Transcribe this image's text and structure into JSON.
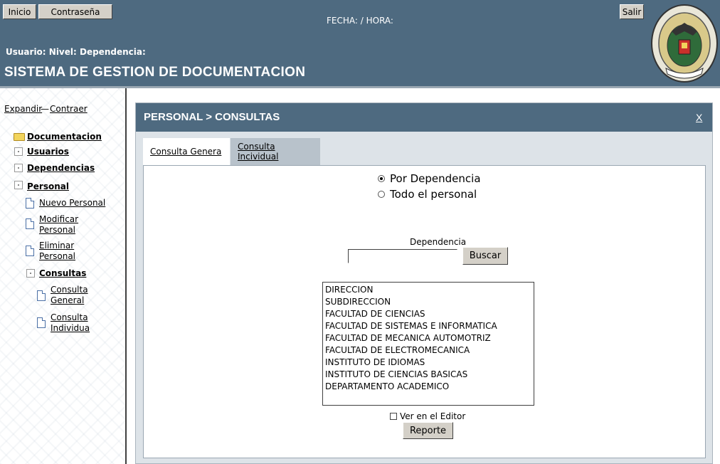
{
  "header": {
    "inicio_label": "Inicio",
    "contrasena_label": "Contraseña",
    "salir_label": "Salir",
    "fecha_text": "FECHA: / HORA:",
    "user_line": "Usuario: Nivel: Dependencia:",
    "system_title": "SISTEMA DE GESTION DE DOCUMENTACION",
    "logo_icon": "institution-seal-icon",
    "colors": {
      "bar": "#4e6a80"
    }
  },
  "sidebar": {
    "expandir": "Expandir",
    "separator": "—",
    "contraer": "Contraer",
    "items": [
      {
        "label": "Documentacion"
      },
      {
        "label": "Usuarios"
      },
      {
        "label": "Dependencias"
      },
      {
        "label": "Personal"
      },
      {
        "label": "Nuevo Personal"
      },
      {
        "label": "Modificar Personal"
      },
      {
        "label": "Eliminar Personal"
      },
      {
        "label": "Consultas"
      },
      {
        "label": "Consulta General"
      },
      {
        "label": "Consulta Individua"
      }
    ]
  },
  "panel": {
    "title": "PERSONAL > CONSULTAS",
    "close_label": "X",
    "tabs": [
      {
        "label": "Consulta Genera"
      },
      {
        "label": "Consulta Incividual"
      }
    ],
    "radio_options": [
      {
        "label": "Por Dependencia",
        "checked": true
      },
      {
        "label": "Todo el personal",
        "checked": false
      }
    ],
    "dependencia_label": "Dependencia",
    "dependencia_value": "",
    "buscar_label": "Buscar",
    "list_items": [
      "DIRECCION",
      "SUBDIRECCION",
      "FACULTAD DE CIENCIAS",
      "FACULTAD DE SISTEMAS E INFORMATICA",
      "FACULTAD DE MECANICA AUTOMOTRIZ",
      "FACULTAD DE ELECTROMECANICA",
      "INSTITUTO DE IDIOMAS",
      "INSTITUTO DE CIENCIAS BASICAS",
      "DEPARTAMENTO ACADEMICO"
    ],
    "ver_editor_label": "Ver en el Editor",
    "ver_editor_checked": false,
    "reporte_label": "Reporte"
  }
}
